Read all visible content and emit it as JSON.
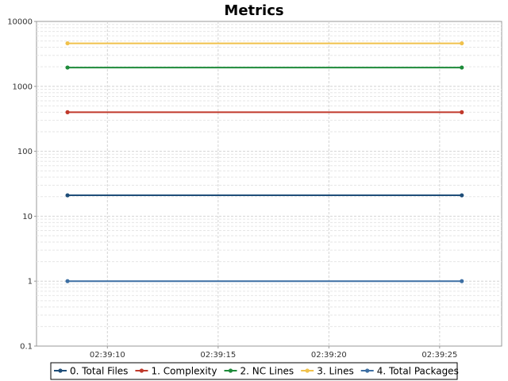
{
  "chart_data": {
    "type": "line",
    "title": "Metrics",
    "xlabel": "",
    "ylabel": "",
    "yscale": "log",
    "ylim": [
      0.1,
      10000
    ],
    "xlim": [
      "02:39:06.8",
      "02:39:27.8"
    ],
    "x": [
      "02:39:08.2",
      "02:39:26.0"
    ],
    "x_ticks": [
      "02:39:10",
      "02:39:15",
      "02:39:20",
      "02:39:25"
    ],
    "y_ticks": [
      "0.1",
      "1",
      "10",
      "100",
      "1000",
      "10000"
    ],
    "grid": true,
    "legend_position": "bottom",
    "series": [
      {
        "name": "0. Total Files",
        "color": "#1f4e79",
        "values": [
          21,
          21
        ]
      },
      {
        "name": "1. Complexity",
        "color": "#c0392b",
        "values": [
          400,
          400
        ]
      },
      {
        "name": "2. NC Lines",
        "color": "#1e8b3a",
        "values": [
          1950,
          1950
        ]
      },
      {
        "name": "3. Lines",
        "color": "#f0c14b",
        "values": [
          4600,
          4600
        ]
      },
      {
        "name": "4. Total Packages",
        "color": "#3d6fa3",
        "values": [
          1,
          1
        ]
      }
    ]
  }
}
